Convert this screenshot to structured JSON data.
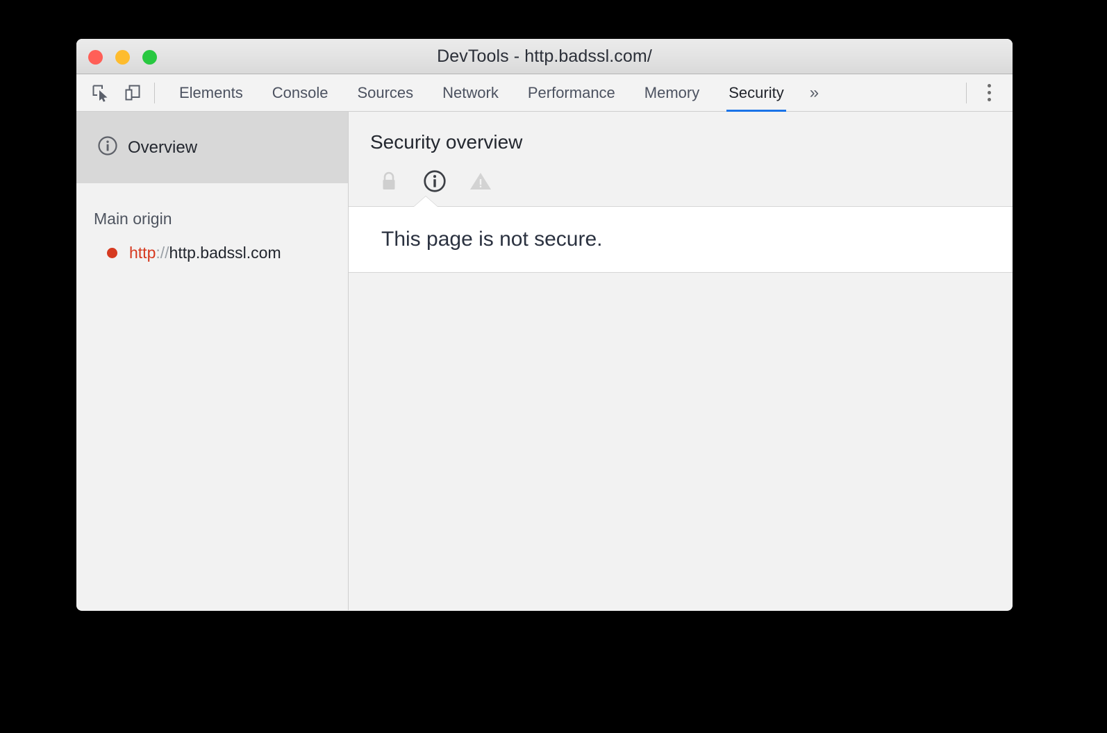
{
  "window": {
    "title": "DevTools - http.badssl.com/",
    "controls": [
      {
        "name": "close",
        "color": "#ff5f57"
      },
      {
        "name": "minimize",
        "color": "#febc2e"
      },
      {
        "name": "maximize",
        "color": "#28c840"
      }
    ]
  },
  "toolbar": {
    "inspect_icon": "inspect-element-icon",
    "device_icon": "device-toolbar-icon",
    "overflow_label": "»",
    "menu_icon": "more-vertical-icon"
  },
  "tabs": [
    {
      "label": "Elements",
      "active": false
    },
    {
      "label": "Console",
      "active": false
    },
    {
      "label": "Sources",
      "active": false
    },
    {
      "label": "Network",
      "active": false
    },
    {
      "label": "Performance",
      "active": false
    },
    {
      "label": "Memory",
      "active": false
    },
    {
      "label": "Security",
      "active": true
    }
  ],
  "accent_color": "#1a73e8",
  "sidebar": {
    "overview": {
      "label": "Overview",
      "icon": "info-circle-icon",
      "selected": true
    },
    "section_title": "Main origin",
    "origins": [
      {
        "state_icon": "red-dot-icon",
        "state_color": "#d63a20",
        "scheme": "http",
        "separator": "://",
        "host": "http.badssl.com"
      }
    ]
  },
  "main": {
    "title": "Security overview",
    "status_icons": [
      {
        "name": "lock-icon",
        "state": "inactive"
      },
      {
        "name": "info-circle-icon",
        "state": "active"
      },
      {
        "name": "warning-triangle-icon",
        "state": "inactive"
      }
    ],
    "summary": "This page is not secure."
  }
}
